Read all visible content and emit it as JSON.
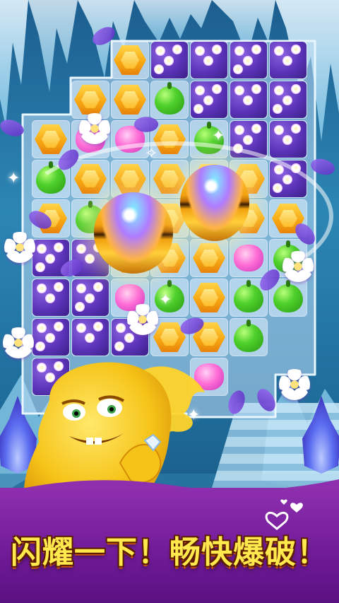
{
  "banner": {
    "slogan": "闪耀一下！畅快爆破！"
  },
  "board": {
    "rows": [
      [
        "empty",
        "empty",
        "hex",
        "purple",
        "purple",
        "purple",
        "purple"
      ],
      [
        "empty",
        "hex",
        "hex",
        "apple",
        "purple",
        "purple",
        "purple"
      ],
      [
        "hex",
        "pink",
        "pink",
        "hex",
        "apple",
        "purple",
        "purple"
      ],
      [
        "apple",
        "hex",
        "hex",
        "hex",
        "hex",
        "hex",
        "purple"
      ],
      [
        "hex",
        "apple",
        "hex",
        "hex",
        "hex",
        "hex",
        "hex"
      ],
      [
        "purple",
        "purple",
        "hex",
        "hex",
        "hex",
        "pink",
        "apple"
      ],
      [
        "purple",
        "purple",
        "pink",
        "apple",
        "hex",
        "apple",
        "apple"
      ],
      [
        "purple",
        "purple",
        "purple",
        "hex",
        "hex",
        "apple",
        "empty"
      ],
      [
        "purple",
        "empty",
        "empty",
        "empty",
        "pink",
        "empty",
        "empty"
      ]
    ]
  },
  "icons": {
    "bomb": "rainbow-bomb-icon",
    "blossom": "white-flower-icon",
    "petal": "purple-petal-icon",
    "heart": "heart-icon"
  },
  "colors": {
    "slogan": "#ffe94d",
    "banner": "#7a1fa0",
    "hex_gem": "#f7a912",
    "apple_gem": "#4fd12c",
    "flower_block": "#5a33b8",
    "pink_gem": "#ff6ed7"
  }
}
